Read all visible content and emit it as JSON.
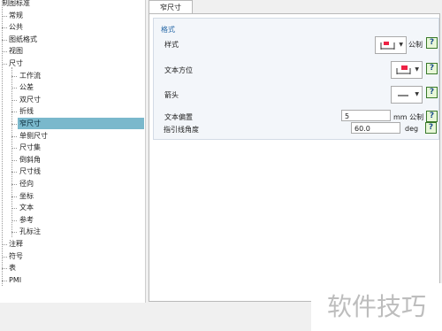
{
  "tree": {
    "items": [
      {
        "label": "制图标准",
        "level": 0
      },
      {
        "label": "常规",
        "level": 1
      },
      {
        "label": "公共",
        "level": 1
      },
      {
        "label": "图纸格式",
        "level": 1
      },
      {
        "label": "视图",
        "level": 1
      },
      {
        "label": "尺寸",
        "level": 1
      },
      {
        "label": "工作流",
        "level": 2
      },
      {
        "label": "公差",
        "level": 2
      },
      {
        "label": "双尺寸",
        "level": 2
      },
      {
        "label": "折线",
        "level": 2
      },
      {
        "label": "窄尺寸",
        "level": 2,
        "selected": true
      },
      {
        "label": "单侧尺寸",
        "level": 2
      },
      {
        "label": "尺寸集",
        "level": 2
      },
      {
        "label": "倒斜角",
        "level": 2
      },
      {
        "label": "尺寸线",
        "level": 2
      },
      {
        "label": "径向",
        "level": 2
      },
      {
        "label": "坐标",
        "level": 2
      },
      {
        "label": "文本",
        "level": 2
      },
      {
        "label": "参考",
        "level": 2
      },
      {
        "label": "孔标注",
        "level": 2
      },
      {
        "label": "注释",
        "level": 1
      },
      {
        "label": "符号",
        "level": 1
      },
      {
        "label": "表",
        "level": 1
      },
      {
        "label": "PMI",
        "level": 1
      }
    ]
  },
  "tab": {
    "label": "窄尺寸"
  },
  "group": {
    "title": "格式",
    "style_label": "样式",
    "style_unit": "公制",
    "text_orientation_label": "文本方位",
    "arrow_label": "箭头",
    "text_offset_label": "文本偏置",
    "text_offset_value": "5",
    "text_offset_unit": "mm 公制",
    "leader_angle_label": "指引线角度",
    "leader_angle_value": "60.0",
    "leader_angle_unit": "deg",
    "help_glyph": "?"
  },
  "watermark": {
    "text": "软件技巧"
  },
  "icons": {
    "style": "narrow-dim-style-icon",
    "orientation": "text-orientation-icon",
    "arrow": "arrow-line-icon",
    "help": "help-icon",
    "dropdown": "chevron-down-icon"
  },
  "colors": {
    "selected_row": "#7ab8cc",
    "group_title": "#2a6aa8",
    "help_border": "#3a7a2a"
  }
}
